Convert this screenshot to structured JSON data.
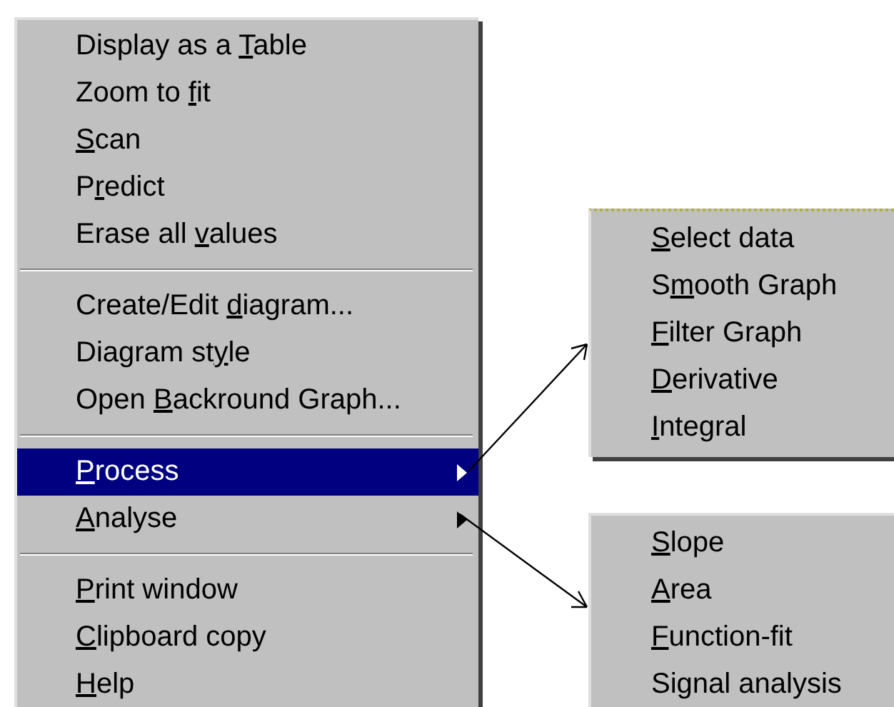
{
  "main_menu": {
    "sections": [
      [
        {
          "before": "Display as a ",
          "key": "T",
          "after": "able",
          "selected": false
        },
        {
          "before": "Zoom to ",
          "key": "f",
          "after": "it",
          "selected": false
        },
        {
          "key": "S",
          "after": "can",
          "selected": false
        },
        {
          "before": "P",
          "key": "r",
          "after": "edict",
          "selected": false
        },
        {
          "before": "Erase all ",
          "key": "v",
          "after": "alues",
          "selected": false
        }
      ],
      [
        {
          "before": "Create/Edit ",
          "key": "d",
          "after": "iagram...",
          "selected": false
        },
        {
          "before": "Diagram st",
          "key": "y",
          "after": "le",
          "selected": false
        },
        {
          "before": "Open ",
          "key": "B",
          "after": "ackround Graph...",
          "selected": false
        }
      ],
      [
        {
          "key": "P",
          "after": "rocess",
          "selected": true,
          "has_submenu": true
        },
        {
          "key": "A",
          "after": "nalyse",
          "selected": false,
          "has_submenu": true
        }
      ],
      [
        {
          "key": "P",
          "after": "rint window",
          "selected": false
        },
        {
          "key": "C",
          "after": "lipboard copy",
          "selected": false
        },
        {
          "key": "H",
          "after": "elp",
          "selected": false
        }
      ]
    ]
  },
  "submenus": [
    {
      "items": [
        {
          "key": "S",
          "after": "elect data",
          "selected": false
        },
        {
          "before": "S",
          "key": "m",
          "after": "ooth Graph",
          "selected": false
        },
        {
          "key": "F",
          "after": "ilter Graph",
          "selected": false
        },
        {
          "key": "D",
          "after": "erivative",
          "selected": false
        },
        {
          "key": "I",
          "after": "ntegral",
          "selected": false
        }
      ]
    },
    {
      "items": [
        {
          "key": "S",
          "after": "lope",
          "selected": false
        },
        {
          "key": "A",
          "after": "rea",
          "selected": false
        },
        {
          "key": "F",
          "after": "unction-fit",
          "selected": false
        },
        {
          "before": "Signal analysis",
          "selected": false
        }
      ]
    }
  ]
}
